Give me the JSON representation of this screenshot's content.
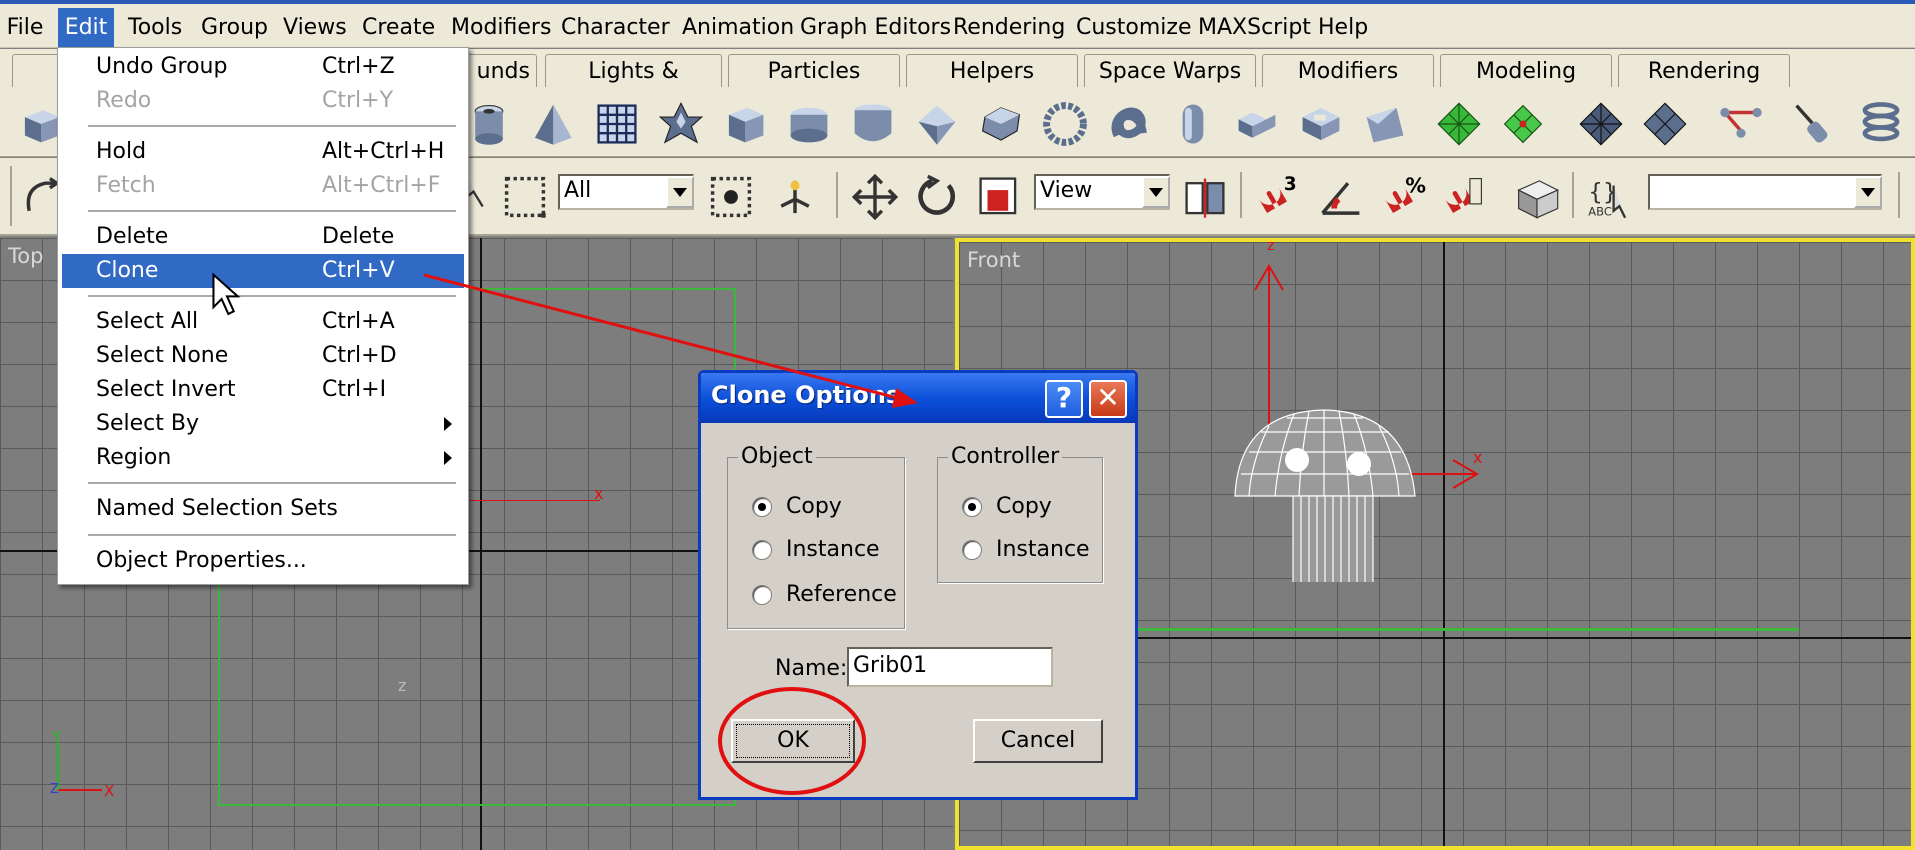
{
  "menubar": {
    "items": [
      {
        "label": "File"
      },
      {
        "label": "Edit"
      },
      {
        "label": "Tools"
      },
      {
        "label": "Group"
      },
      {
        "label": "Views"
      },
      {
        "label": "Create"
      },
      {
        "label": "Modifiers"
      },
      {
        "label": "Character"
      },
      {
        "label": "Animation"
      },
      {
        "label": "Graph Editors"
      },
      {
        "label": "Rendering"
      },
      {
        "label": "Customize"
      },
      {
        "label": "MAXScript"
      },
      {
        "label": "Help"
      }
    ]
  },
  "tabs": [
    {
      "label": "unds"
    },
    {
      "label": "Lights & Cameras"
    },
    {
      "label": "Particles"
    },
    {
      "label": "Helpers"
    },
    {
      "label": "Space Warps"
    },
    {
      "label": "Modifiers"
    },
    {
      "label": "Modeling"
    },
    {
      "label": "Rendering"
    }
  ],
  "toolbar": {
    "selection_filter": "All",
    "ref_coord": "View",
    "named_selection": ""
  },
  "edit_menu": {
    "items": [
      {
        "label": "Undo Group",
        "shortcut": "Ctrl+Z"
      },
      {
        "label": "Redo",
        "shortcut": "Ctrl+Y"
      },
      {
        "label": "Hold",
        "shortcut": "Alt+Ctrl+H"
      },
      {
        "label": "Fetch",
        "shortcut": "Alt+Ctrl+F"
      },
      {
        "label": "Delete",
        "shortcut": "Delete"
      },
      {
        "label": "Clone",
        "shortcut": "Ctrl+V"
      },
      {
        "label": "Select All",
        "shortcut": "Ctrl+A"
      },
      {
        "label": "Select None",
        "shortcut": "Ctrl+D"
      },
      {
        "label": "Select Invert",
        "shortcut": "Ctrl+I"
      },
      {
        "label": "Select By",
        "shortcut": ""
      },
      {
        "label": "Region",
        "shortcut": ""
      },
      {
        "label": "Named Selection Sets",
        "shortcut": ""
      },
      {
        "label": "Object Properties...",
        "shortcut": ""
      }
    ]
  },
  "viewports": {
    "top": {
      "label": "Top",
      "axis_x": "x",
      "axis_z": "z",
      "gizmo_x": "X",
      "gizmo_y": "Y",
      "gizmo_z": "Z"
    },
    "front": {
      "label": "Front",
      "axis_x": "x",
      "axis_z": "z"
    }
  },
  "dialog": {
    "title": "Clone Options",
    "help_label": "?",
    "close_label": "✕",
    "object_group": {
      "title": "Object",
      "options": [
        "Copy",
        "Instance",
        "Reference"
      ],
      "selected": "Copy"
    },
    "controller_group": {
      "title": "Controller",
      "options": [
        "Copy",
        "Instance"
      ],
      "selected": "Copy"
    },
    "name_label": "Name:",
    "name_value": "Grib01",
    "ok_label": "OK",
    "cancel_label": "Cancel"
  },
  "colors": {
    "accent": "#316ac5",
    "annotation": "#e01010",
    "selection": "#3cb83c",
    "active_viewport": "#f0e030"
  }
}
